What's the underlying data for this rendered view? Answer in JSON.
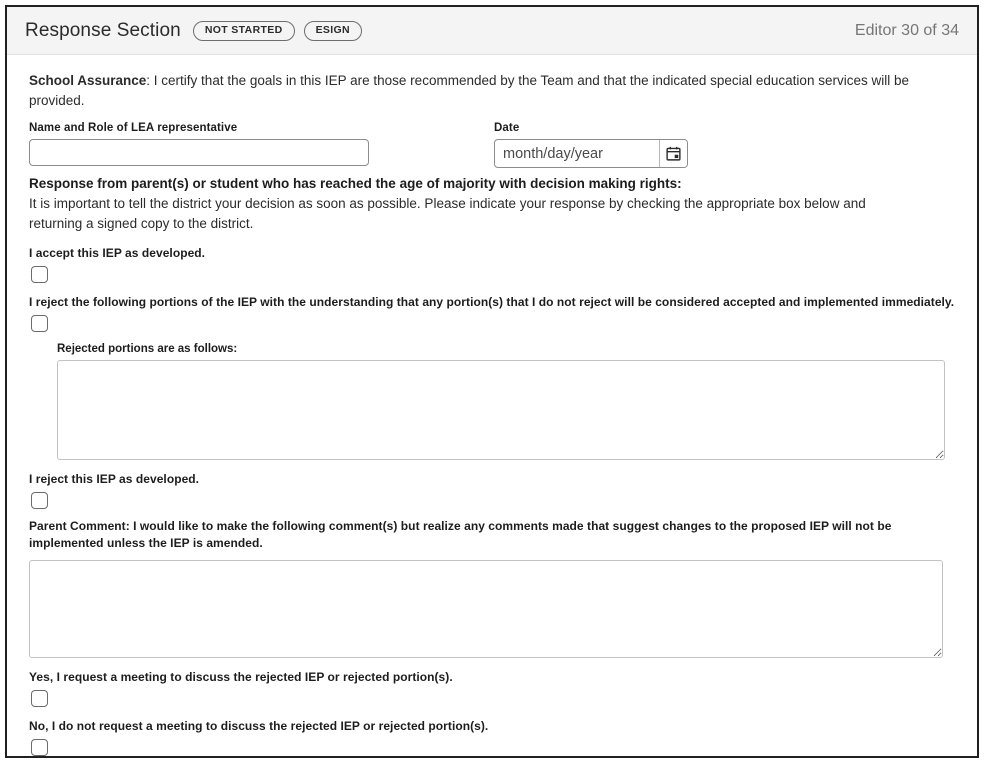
{
  "header": {
    "title": "Response Section",
    "badges": [
      {
        "name": "status-badge",
        "label": "NOT STARTED"
      },
      {
        "name": "esign-badge",
        "label": "ESIGN"
      }
    ],
    "editor_count": "Editor 30 of 34"
  },
  "assurance": {
    "lead": "School Assurance",
    "text": ": I certify that the goals in this IEP are those recommended by the Team and that the indicated special education services will be provided."
  },
  "fields": {
    "lea": {
      "label": "Name and Role of LEA representative",
      "value": "",
      "placeholder": ""
    },
    "date": {
      "label": "Date",
      "value": "",
      "placeholder": "month/day/year",
      "icon": "calendar-icon"
    }
  },
  "response": {
    "heading": "Response from parent(s) or student who has reached the age of majority with decision making rights:",
    "instructions": "It is important to tell the district your decision as soon as possible. Please indicate your response by checking the appropriate box below and returning a signed copy to the district."
  },
  "options": {
    "accept": {
      "label": "I accept this IEP as developed.",
      "checked": false
    },
    "reject_portions": {
      "label": "I reject the following portions of the IEP with the understanding that any portion(s) that I do not reject will be considered accepted and implemented immediately.",
      "checked": false
    },
    "rejected_portions_text": {
      "label": "Rejected portions are as follows:",
      "value": "",
      "placeholder": ""
    },
    "reject_all": {
      "label": "I reject this IEP as developed.",
      "checked": false
    },
    "parent_comment": {
      "label": "Parent Comment: I would like to make the following comment(s) but realize any comments made that suggest changes to the proposed IEP will not be implemented unless the IEP is amended.",
      "value": "",
      "placeholder": ""
    },
    "meeting_yes": {
      "label": "Yes, I request a meeting to discuss the rejected IEP or rejected portion(s).",
      "checked": false
    },
    "meeting_no": {
      "label": "No, I do not request a meeting to discuss the rejected IEP or rejected portion(s).",
      "checked": false
    }
  },
  "colors": {
    "frame_border": "#231f20",
    "header_bg": "#f4f4f4",
    "text": "#2b2b2b",
    "muted": "#767676",
    "input_border": "#8c8c8c",
    "textarea_border": "#c2c2c2"
  }
}
